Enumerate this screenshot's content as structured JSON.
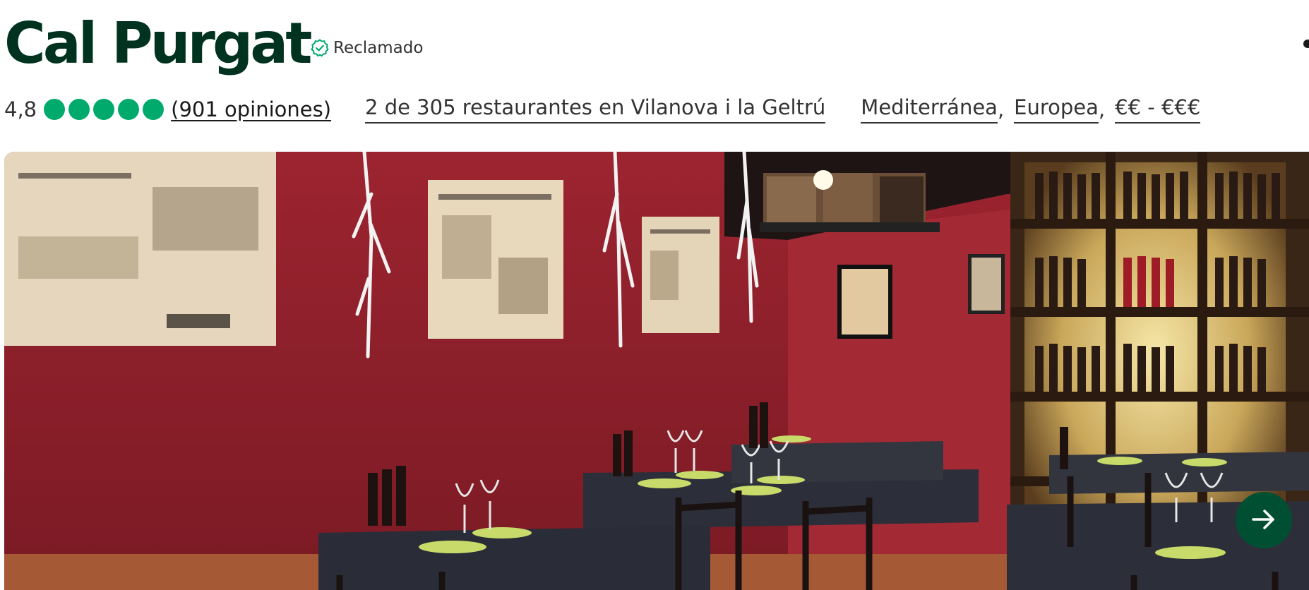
{
  "restaurant": {
    "name": "Cal Purgat",
    "claimed_label": "Reclamado"
  },
  "rating": {
    "value": "4,8",
    "bubbles": 5,
    "max_bubbles": 5,
    "reviews_label": "(901 opiniones)"
  },
  "ranking": {
    "text": "2 de 305 restaurantes en Vilanova i la Geltrú"
  },
  "tags": {
    "cuisine1": "Mediterránea",
    "cuisine2": "Europea",
    "price": "€€ - €€€",
    "separator": ","
  },
  "gallery": {
    "next_icon": "arrow-right-icon"
  },
  "colors": {
    "brand_dark": "#00331f",
    "bubble_green": "#00aa6c",
    "button_green": "#004f32"
  }
}
